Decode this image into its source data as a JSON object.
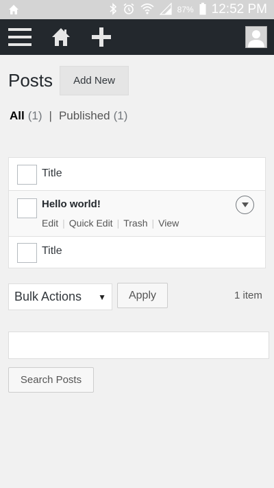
{
  "status_bar": {
    "battery": "87%",
    "time": "12:52 PM",
    "icons": [
      "home-icon",
      "bluetooth-icon",
      "alarm-icon",
      "wifi-icon",
      "signal-icon",
      "battery-icon"
    ]
  },
  "admin_bar": {
    "icons": [
      "menu-icon",
      "home-icon",
      "plus-icon",
      "avatar-icon"
    ]
  },
  "page": {
    "title": "Posts",
    "add_new": "Add New"
  },
  "filters": {
    "all_label": "All",
    "all_count": "(1)",
    "separator": "|",
    "published_label": "Published",
    "published_count": "(1)"
  },
  "table": {
    "header_title": "Title",
    "footer_title": "Title",
    "rows": [
      {
        "title": "Hello world!",
        "actions": [
          "Edit",
          "Quick Edit",
          "Trash",
          "View"
        ]
      }
    ]
  },
  "bulk": {
    "selected": "Bulk Actions",
    "apply": "Apply",
    "items": "1 item"
  },
  "search": {
    "value": "",
    "button": "Search Posts"
  },
  "colors": {
    "admin_bar_bg": "#23282d",
    "page_bg": "#f1f1f1",
    "status_bar_bg": "#d4d4d4"
  }
}
